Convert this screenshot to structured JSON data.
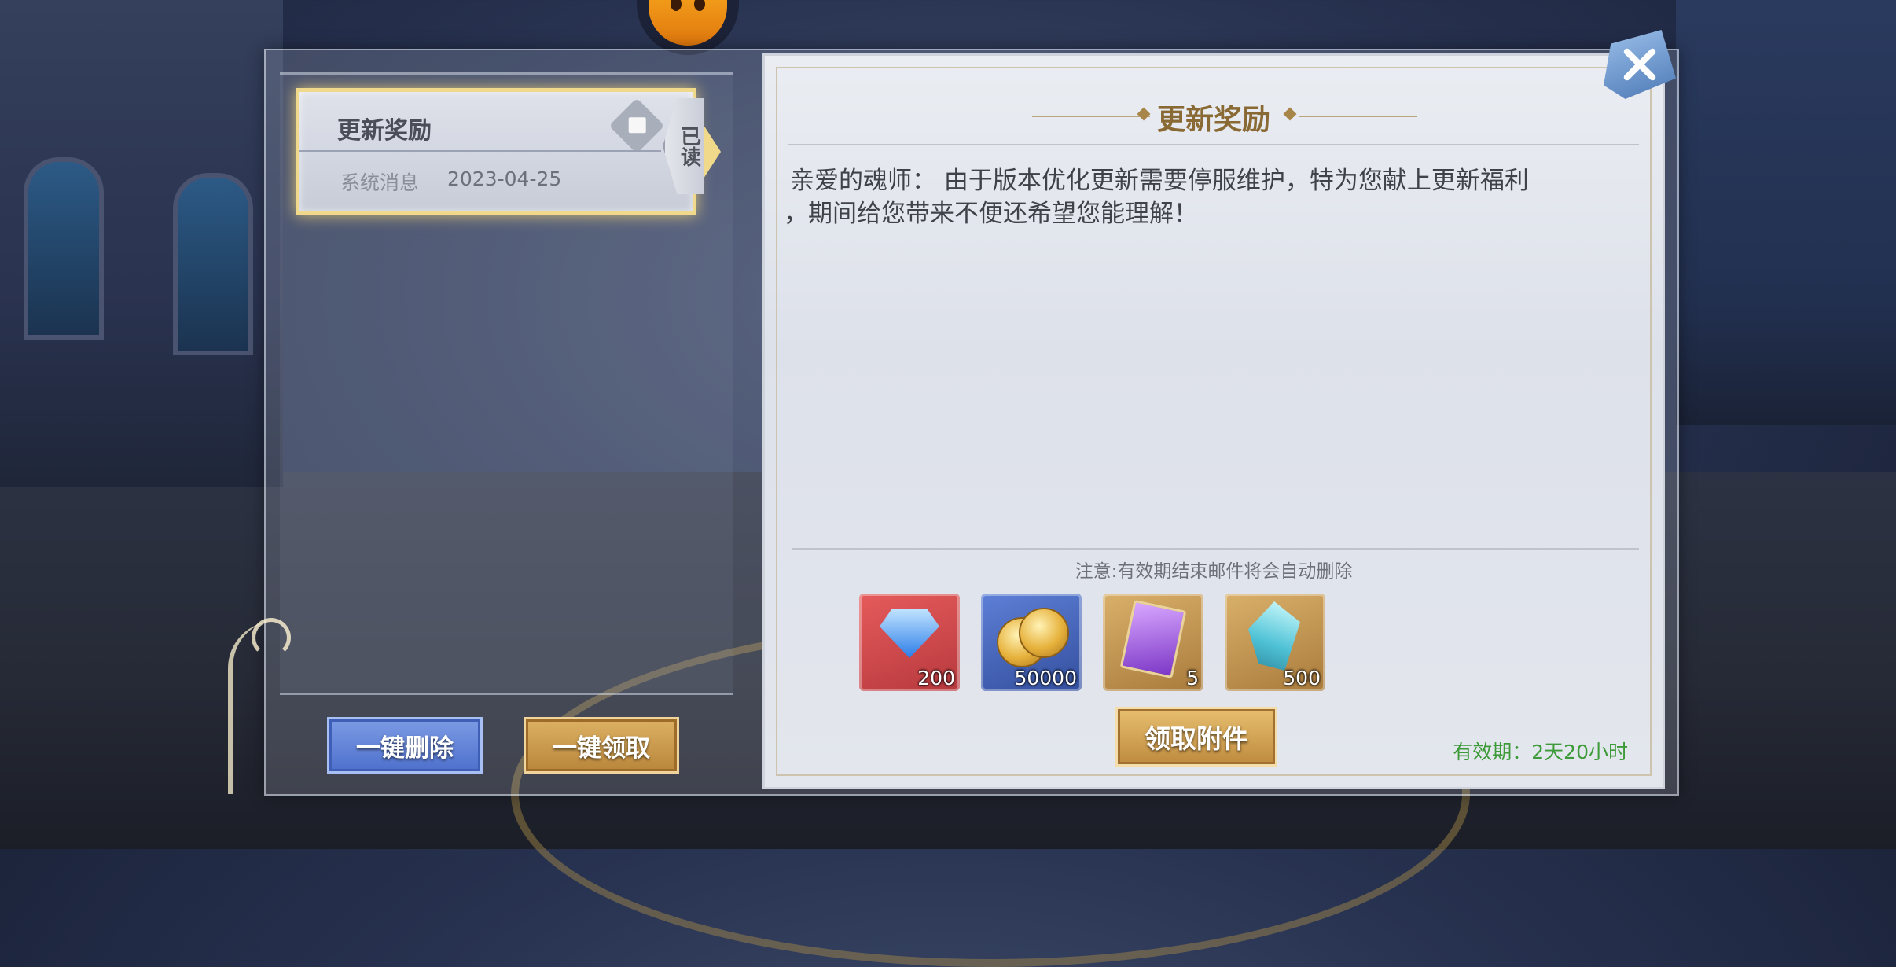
{
  "mail_list": {
    "items": [
      {
        "title": "更新奖励",
        "sender": "系统消息",
        "date": "2023-04-25",
        "status": "已读"
      }
    ],
    "delete_all_label": "一键删除",
    "claim_all_label": "一键领取"
  },
  "mail_detail": {
    "title": "更新奖励",
    "body_line1": "亲爱的魂师： 由于版本优化更新需要停服维护，特为您献上更新福利",
    "body_line2": "，期间给您带来不便还希望您能理解！",
    "notice": "注意:有效期结束邮件将会自动删除",
    "rewards": [
      {
        "icon": "diamond-icon",
        "quantity": "200"
      },
      {
        "icon": "gold-coin-icon",
        "quantity": "50000"
      },
      {
        "icon": "purple-card-icon",
        "quantity": "5"
      },
      {
        "icon": "crystal-shard-icon",
        "quantity": "500"
      }
    ],
    "claim_label": "领取附件",
    "validity": "有效期：2天20小时"
  },
  "colors": {
    "gold_accent": "#f1d98b",
    "title_gold": "#8a6a34",
    "delete_blue": "#4e70cc",
    "claim_gold": "#bf8b3e",
    "validity_green": "#3d9a38"
  }
}
